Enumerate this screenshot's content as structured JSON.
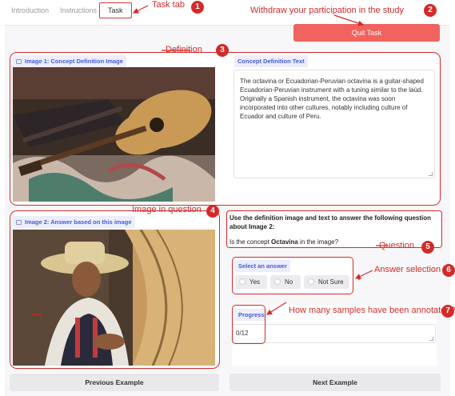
{
  "tabs": [
    {
      "label": "Introduction",
      "active": false
    },
    {
      "label": "Instructions",
      "active": false
    },
    {
      "label": "Task",
      "active": true
    }
  ],
  "quit_button": "Quit Task",
  "definition": {
    "image_label": "Image 1: Concept Definition Image",
    "text_label": "Concept Definition Text",
    "text": "The octavina or Ecuadorian-Peruvian octavina is a guitar-shaped Ecuadorian-Peruvian instrument with a tuning similar to the laúd. Originally a Spanish instrument, the octavina was soon incorporated into other cultures, notably including culture of Ecuador and culture of Peru."
  },
  "question_image_label": "Image 2: Answer based on this image",
  "question": {
    "instruction": "Use the definition image and text to answer the following question about Image 2:",
    "prefix": "Is the concept ",
    "concept": "Octavina",
    "suffix": " in the image?"
  },
  "answer": {
    "label": "Select an answer",
    "options": [
      "Yes",
      "No",
      "Not Sure"
    ]
  },
  "progress": {
    "label": "Progress",
    "value": "0/12"
  },
  "nav": {
    "previous": "Previous Example",
    "next": "Next Example"
  },
  "annotations": {
    "task_tab": "Task tab",
    "withdraw": "Withdraw your participation in the study",
    "definition": "Definition",
    "image_in_question": "Image in question",
    "question": "Question",
    "answer_selection": "Answer selection",
    "progress": "How many samples have been annotated?",
    "numbers": [
      "1",
      "2",
      "3",
      "4",
      "5",
      "6",
      "7"
    ]
  },
  "colors": {
    "accent": "#f2625e",
    "annotation": "#d42a2a",
    "badge_text": "#4a5ad6"
  }
}
